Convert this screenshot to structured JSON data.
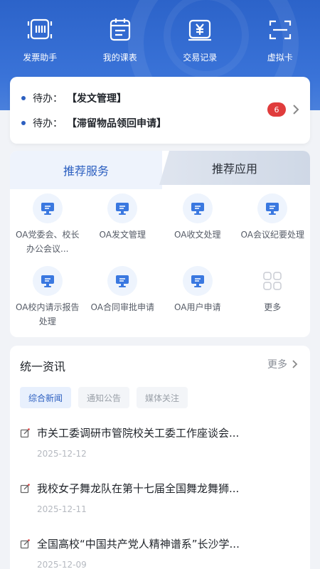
{
  "quick_actions": [
    {
      "label": "发票助手",
      "icon": "invoice-icon"
    },
    {
      "label": "我的课表",
      "icon": "schedule-icon"
    },
    {
      "label": "交易记录",
      "icon": "transaction-icon"
    },
    {
      "label": "虚拟卡",
      "icon": "scan-card-icon"
    }
  ],
  "todos": [
    {
      "prefix": "待办：",
      "text": "【发文管理】"
    },
    {
      "prefix": "待办：",
      "text": "【滞留物品领回申请】"
    }
  ],
  "todo_badge": "6",
  "service_tabs": {
    "active": "推荐服务",
    "inactive": "推荐应用"
  },
  "services": [
    {
      "name": "OA党委会、校长办公会议..."
    },
    {
      "name": "OA发文管理"
    },
    {
      "name": "OA收文处理"
    },
    {
      "name": "OA会议纪要处理"
    },
    {
      "name": "OA校内请示报告处理"
    },
    {
      "name": "OA合同审批申请"
    },
    {
      "name": "OA用户申请"
    },
    {
      "name": "更多"
    }
  ],
  "news": {
    "title": "统一资讯",
    "more": "更多",
    "tabs": [
      "综合新闻",
      "通知公告",
      "媒体关注"
    ],
    "items": [
      {
        "headline": "市关工委调研市管院校关工委工作座谈会...",
        "date": "2025-12-12"
      },
      {
        "headline": "我校女子舞龙队在第十七届全国舞龙舞狮...",
        "date": "2025-12-11"
      },
      {
        "headline": "全国高校“中国共产党人精神谱系”长沙学...",
        "date": "2025-12-09"
      }
    ]
  },
  "colors": {
    "primary": "#2c63c9",
    "badge": "#e03c3c",
    "accent": "#2c5fc0"
  }
}
